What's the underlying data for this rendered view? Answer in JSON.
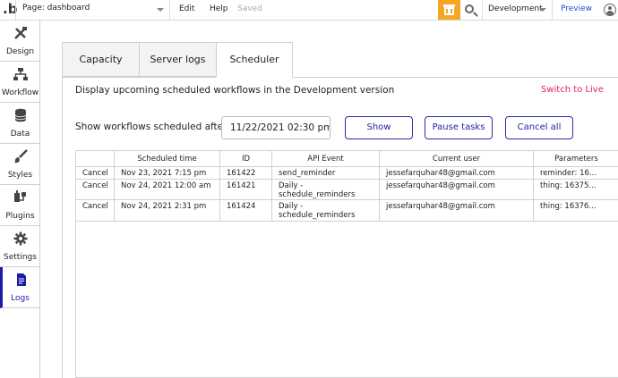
{
  "topbar": {
    "logo": ".b",
    "page_select": "Page: dashboard",
    "menu_edit": "Edit",
    "menu_help": "Help",
    "save_status": "Saved",
    "environment": "Development",
    "preview": "Preview"
  },
  "sidebar": {
    "items": [
      {
        "label": "Design",
        "icon": "design-icon"
      },
      {
        "label": "Workflow",
        "icon": "workflow-icon"
      },
      {
        "label": "Data",
        "icon": "data-icon"
      },
      {
        "label": "Styles",
        "icon": "styles-icon"
      },
      {
        "label": "Plugins",
        "icon": "plugins-icon"
      },
      {
        "label": "Settings",
        "icon": "settings-icon"
      },
      {
        "label": "Logs",
        "icon": "logs-icon",
        "active": true
      }
    ]
  },
  "tabs": [
    {
      "label": "Capacity"
    },
    {
      "label": "Server logs"
    },
    {
      "label": "Scheduler",
      "active": true
    }
  ],
  "scheduler": {
    "description": "Display upcoming scheduled workflows in the Development version",
    "switch_live": "Switch to Live",
    "show_after_label": "Show workflows scheduled after",
    "date_value": "11/22/2021 02:30 pm",
    "show_button": "Show",
    "pause_button": "Pause tasks",
    "cancel_all_button": "Cancel all"
  },
  "table": {
    "headers": [
      "",
      "Scheduled time",
      "ID",
      "API Event",
      "Current user",
      "Parameters"
    ],
    "rows": [
      {
        "action": "Cancel",
        "time": "Nov 23, 2021 7:15 pm",
        "id": "161422",
        "event": "send_reminder",
        "user": "jessefarquhar48@gmail.com",
        "params": "reminder: 16..."
      },
      {
        "action": "Cancel",
        "time": "Nov 24, 2021 12:00 am",
        "id": "161421",
        "event": "Daily - schedule_reminders",
        "user": "jessefarquhar48@gmail.com",
        "params": "thing: 16375..."
      },
      {
        "action": "Cancel",
        "time": "Nov 24, 2021 2:31 pm",
        "id": "161424",
        "event": "Daily - schedule_reminders",
        "user": "jessefarquhar48@gmail.com",
        "params": "thing: 16376..."
      }
    ]
  },
  "colors": {
    "accent": "#1d1da8",
    "live_link": "#e0245e",
    "gift": "#f5a623",
    "preview": "#1d4ed8"
  }
}
